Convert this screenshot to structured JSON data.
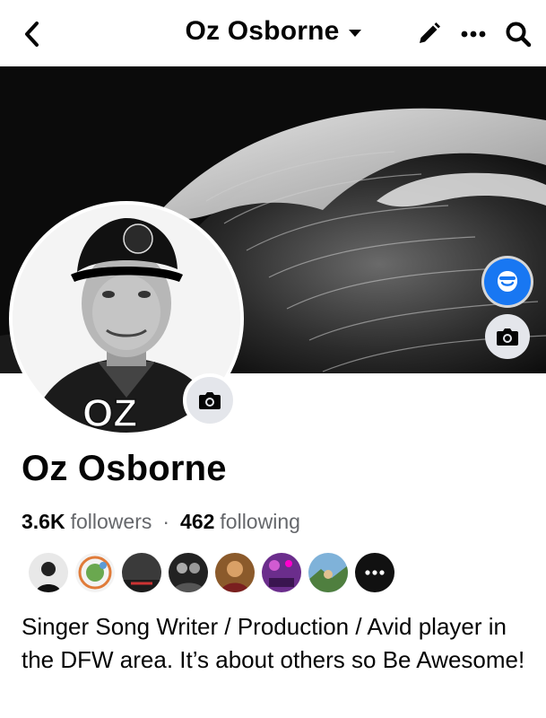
{
  "header": {
    "title": "Oz Osborne",
    "icons": [
      "back-arrow-icon",
      "pencil-icon",
      "more-dots-icon",
      "search-icon"
    ]
  },
  "cover": {
    "description_icon": "wave-photo"
  },
  "avatar": {
    "badge_text": "OZ"
  },
  "profile": {
    "name": "Oz Osborne",
    "followers_count": "3.6K",
    "followers_label": "followers",
    "separator": "·",
    "following_count": "462",
    "following_label": "following",
    "bio": "Singer Song Writer / Production / Avid player in the DFW area. It’s about others so Be Awesome!"
  },
  "friends": {
    "count_shown": 8
  },
  "colors": {
    "brand_blue": "#1877f2",
    "secondary_text": "#65676b",
    "button_gray": "#e4e6eb"
  }
}
